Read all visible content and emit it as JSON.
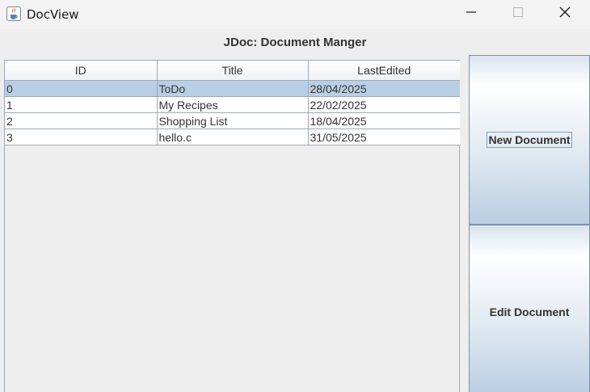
{
  "window": {
    "title": "DocView",
    "icon": "java-cup-icon",
    "controls": [
      "minimize-icon",
      "maximize-icon",
      "close-icon"
    ]
  },
  "header": {
    "title": "JDoc: Document Manger"
  },
  "table": {
    "columns": [
      "ID",
      "Title",
      "LastEdited"
    ],
    "rows": [
      {
        "id": "0",
        "title": "ToDo",
        "last_edited": "28/04/2025",
        "selected": true
      },
      {
        "id": "1",
        "title": "My Recipes",
        "last_edited": "22/02/2025",
        "selected": false
      },
      {
        "id": "2",
        "title": "Shopping List",
        "last_edited": "18/04/2025",
        "selected": false
      },
      {
        "id": "3",
        "title": "hello.c",
        "last_edited": "31/05/2025",
        "selected": false
      }
    ],
    "selection_color": "#b8cfe5"
  },
  "buttons": {
    "new_document": "New Document",
    "edit_document": "Edit Document"
  }
}
